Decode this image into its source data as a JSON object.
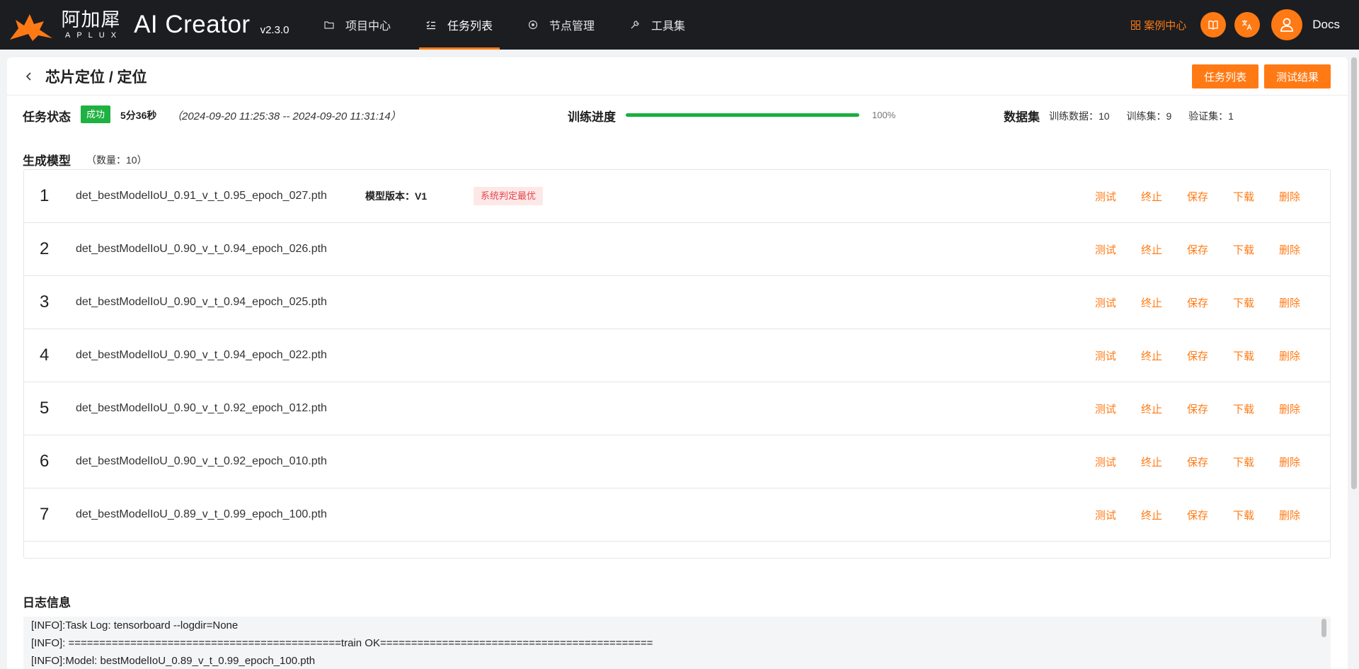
{
  "brand": {
    "cn_name": "阿加犀",
    "en_name": "APLUX",
    "product": "AI Creator",
    "version": "v2.3.0",
    "accent": "#ff7a14"
  },
  "nav": {
    "items": [
      {
        "label": "项目中心",
        "icon": "folder-icon"
      },
      {
        "label": "任务列表",
        "icon": "task-list-icon",
        "active": true
      },
      {
        "label": "节点管理",
        "icon": "node-icon"
      },
      {
        "label": "工具集",
        "icon": "wrench-icon"
      }
    ]
  },
  "top_right": {
    "case_center": "案例中心",
    "docs": "Docs"
  },
  "page": {
    "title": "芯片定位 / 定位",
    "btn_task_list": "任务列表",
    "btn_test_results": "测试结果"
  },
  "status": {
    "label": "任务状态",
    "badge": "成功",
    "duration": "5分36秒",
    "time_range": "（2024-09-20 11:25:38 -- 2024-09-20 11:31:14）",
    "progress_label": "训练进度",
    "progress_value": 100,
    "progress_text": "100%",
    "dataset_label": "数据集",
    "train_data": "训练数据：10",
    "train_set": "训练集：9",
    "val_set": "验证集：1"
  },
  "models": {
    "title": "生成模型",
    "count": "（数量：10）",
    "actions": [
      "测试",
      "终止",
      "保存",
      "下载",
      "删除"
    ],
    "version_label": "模型版本：V1",
    "best_tag": "系统判定最优",
    "rows": [
      {
        "index": "1",
        "file": "det_bestModelIoU_0.91_v_t_0.95_epoch_027.pth"
      },
      {
        "index": "2",
        "file": "det_bestModelIoU_0.90_v_t_0.94_epoch_026.pth"
      },
      {
        "index": "3",
        "file": "det_bestModelIoU_0.90_v_t_0.94_epoch_025.pth"
      },
      {
        "index": "4",
        "file": "det_bestModelIoU_0.90_v_t_0.94_epoch_022.pth"
      },
      {
        "index": "5",
        "file": "det_bestModelIoU_0.90_v_t_0.92_epoch_012.pth"
      },
      {
        "index": "6",
        "file": "det_bestModelIoU_0.90_v_t_0.92_epoch_010.pth"
      },
      {
        "index": "7",
        "file": "det_bestModelIoU_0.89_v_t_0.99_epoch_100.pth"
      }
    ]
  },
  "log": {
    "title": "日志信息",
    "lines": [
      "[INFO]:Task Log: tensorboard --logdir=None",
      "[INFO]: ============================================train OK============================================",
      "[INFO]:Model: bestModelIoU_0.89_v_t_0.99_epoch_100.pth"
    ]
  }
}
